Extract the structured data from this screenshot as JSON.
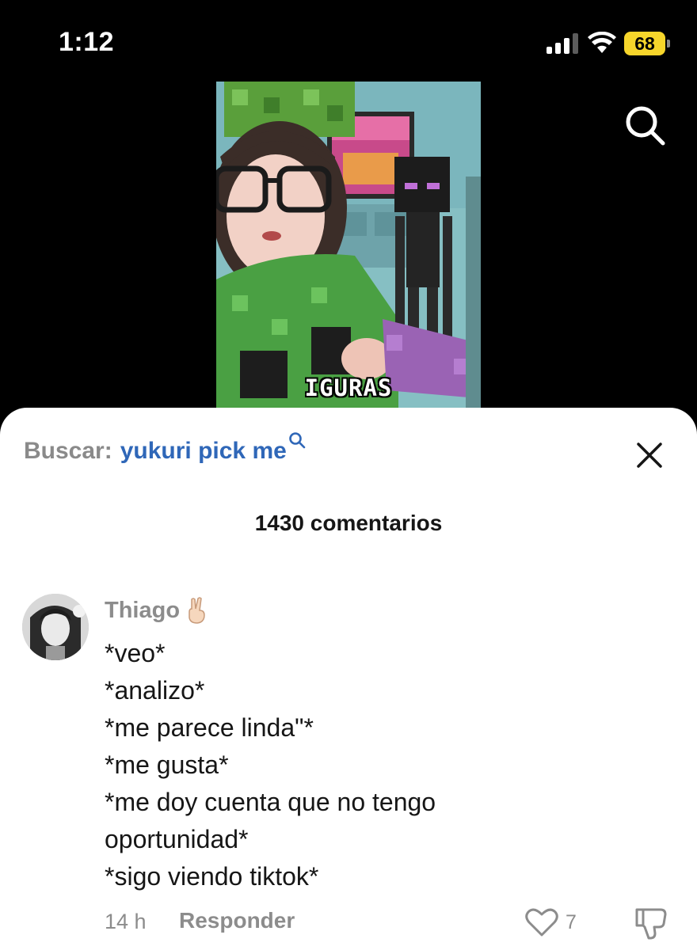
{
  "status_bar": {
    "time": "1:12",
    "battery_level": "68",
    "signal_bars": 3,
    "icons": [
      "signal-icon",
      "wifi-icon",
      "battery-icon"
    ]
  },
  "video": {
    "caption": "IGURAS"
  },
  "header": {
    "search_icon": "search-icon"
  },
  "search": {
    "prefix": "Buscar:",
    "query": "yukuri pick me",
    "query_icon": "search-icon",
    "close_icon": "close-icon"
  },
  "comments": {
    "count_label": "1430 comentarios",
    "items": [
      {
        "author": "Thiago",
        "author_emoji": "peace-hand-icon",
        "lines": [
          "*veo*",
          "*analizo*",
          "*me parece linda\"*",
          "*me gusta*",
          "*me doy cuenta que no tengo",
          "oportunidad*",
          "*sigo viendo tiktok*"
        ],
        "timestamp": "14 h",
        "reply_label": "Responder",
        "likes": "7",
        "like_icon": "heart-icon",
        "dislike_icon": "thumbs-down-icon"
      }
    ]
  },
  "colors": {
    "link_blue": "#2f67b8",
    "muted_gray": "#8c8c8c",
    "battery_yellow": "#f7d62b"
  }
}
